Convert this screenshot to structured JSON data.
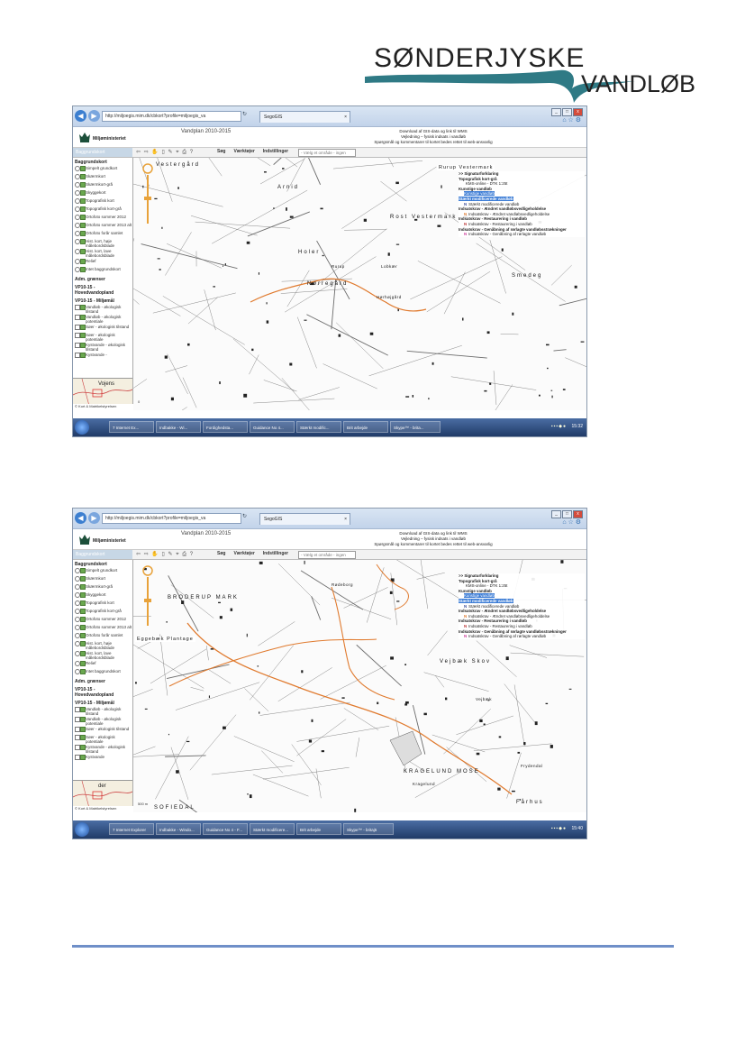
{
  "logo": {
    "line1": "SØNDERJYSKE",
    "line2": "VANDLØB",
    "swoosh_color": "#2f7a85"
  },
  "screenshots": [
    {
      "browser": {
        "url": "http://miljoegis.mim.dk/cbkort?profile=miljoegis_va",
        "tab_title": "SegoGIS",
        "tab_close": "×"
      },
      "app": {
        "ministry": "Miljøministeriet",
        "title": "Vandplan 2010-2015",
        "download_line": "Download af GIS-data og link til WMS",
        "guide_line": "Vejledning – fysisk indsats i vandløb",
        "comments_line": "Spørgsmål og kommentarer til kortet bedes rettet til web-ansvarlig"
      },
      "toolbar": {
        "tab": "Baggrundskort",
        "menu": [
          "Søg",
          "Værktøjer",
          "Indstillinger"
        ],
        "select": "- Vælg et område - ingen"
      },
      "sidebar": {
        "section1": "Baggrundskort",
        "items": [
          "Simpelt grundkort",
          "Skærmkort",
          "Skærmkort-grå",
          "Skyggekort",
          "Topografisk kort",
          "Topografisk kort-grå",
          "Ortofoto sommer 2012",
          "Ortofoto sommer 2013 alt",
          "Ortofoto forår samlet",
          "Hist. kort, høje målebordsblade",
          "Hist. kort, lave målebordsblade",
          "Relief",
          "Intet baggrundskort"
        ],
        "section2": "Adm. grænser",
        "section3": "VP10-15 - Hovedvandopland",
        "section4": "VP10-15 - Miljømål",
        "items2": [
          "Vandløb - økologisk tilstand",
          "Vandløb - økologisk potentiale",
          "Søer - økologisk tilstand",
          "Søer - økologisk potentiale",
          "Kystvande - økologisk tilstand",
          "Kystvande -"
        ],
        "credit": "© Kort & Matrikelstyrelsen"
      },
      "map": {
        "labels": [
          "Vestergård",
          "Arnid",
          "Rost Vestermark",
          "Holer",
          "Nørregård",
          "Smedeg"
        ],
        "box_label": "Rurup Vestermark",
        "minimap_label": "Vojens",
        "scale": "0",
        "small_labels": [
          "Lobkær",
          "Hørhøjgård",
          "Rurup"
        ]
      },
      "legend": {
        "header": ">> Signaturforklaring",
        "topo": "Topografisk kort-grå",
        "topo_sub": "KMS-online - DTK 1:25t",
        "kunstige": "Kunstige vandløb",
        "kunstige_item": "Kunstige vandløb",
        "staerkt": "Stærkt modificerede vandløb",
        "staerkt_item": "Stærkt modificerede vandløb",
        "indsats1": "Indsatskrav - Ændret vandløbsvedligeholdelse",
        "indsats1_item": "Indsatskrav - Ændret vandløbsvedligeholdelse",
        "indsats2": "Indsatskrav - Restaurering i vandløb",
        "indsats2_item": "Indsatskrav - Restaurering i vandløb",
        "indsats3": "Indsatskrav - Genåbning af rørlagte vandløbsstrækninger",
        "indsats3_item": "Indsatskrav - Genåbning af rørlagte vandløb"
      },
      "taskbar": {
        "items": [
          "7 Internet Ex...",
          "Indbakke - Wi...",
          "Fordighedsta...",
          "Guidance No 4...",
          "Stærkt modific...",
          "Brit arbejde"
        ],
        "extra": "Skype™ - brita...",
        "clock": "15:32"
      }
    },
    {
      "browser": {
        "url": "http://miljoegis.mim.dk/cbkort?profile=miljoegis_va",
        "tab_title": "SegoGIS",
        "tab_close": "×"
      },
      "app": {
        "ministry": "Miljøministeriet",
        "title": "Vandplan 2010-2015",
        "download_line": "Download af GIS-data og link til WMS",
        "guide_line": "Vejledning – fysisk indsats i vandløb",
        "comments_line": "Spørgsmål og kommentarer til kortet bedes rettet til web-ansvarlig"
      },
      "toolbar": {
        "tab": "Baggrundskort",
        "menu": [
          "Søg",
          "Værktøjer",
          "Indstillinger"
        ],
        "select": "- Vælg et område - ingen"
      },
      "sidebar": {
        "section1": "Baggrundskort",
        "items": [
          "Simpelt grundkort",
          "Skærmkort",
          "Skærmkort-grå",
          "Skyggekort",
          "Topografisk kort",
          "Topografisk kort-grå",
          "Ortofoto sommer 2012",
          "Ortofoto sommer 2013 alt",
          "Ortofoto forår samlet",
          "Hist. kort, høje målebordsblade",
          "Hist. kort, lave målebordsblade",
          "Relief",
          "Intet baggrundskort"
        ],
        "section2": "Adm. grænser",
        "section3": "VP10-15 - Hovedvandopland",
        "section4": "VP10-15 - Miljømål",
        "items2": [
          "Vandløb - økologisk tilstand",
          "Vandløb - økologisk potentiale",
          "Søer - økologisk tilstand",
          "Søer - økologisk potentiale",
          "Kystvande - økologisk tilstand",
          "Kystvande"
        ],
        "credit": "© Kort & Matrikelstyrelsen"
      },
      "map": {
        "labels": [
          "BRODERUP MARK",
          "Vejbæk Skov",
          "KRAGELUND MOSE",
          "SOFIEDAL",
          "Fårhus"
        ],
        "box_label": "Eggebæk Plantage",
        "minimap_label": "der",
        "scale": "500 m",
        "small_labels": [
          "Rødeborg",
          "Frydendal",
          "Kragelund",
          "Vejbæk"
        ]
      },
      "legend": {
        "header": ">> Signaturforklaring",
        "topo": "Topografisk kort-grå",
        "topo_sub": "KMS-online - DTK 1:25t",
        "kunstige": "Kunstige vandløb",
        "kunstige_item": "Kunstige vandløb",
        "staerkt": "Stærkt modificerede vandløb",
        "staerkt_item": "Stærkt modificerede vandløb",
        "indsats1": "Indsatskrav - Ændret vandløbsvedligeholdelse",
        "indsats1_item": "Indsatskrav - Ændret vandløbsvedligeholdelse",
        "indsats2": "Indsatskrav - Restaurering i vandløb",
        "indsats2_item": "Indsatskrav - Restaurering i vandløb",
        "indsats3": "Indsatskrav - Genåbning af rørlagte vandløbsstrækninger",
        "indsats3_item": "Indsatskrav - Genåbning af rørlagte vandløb"
      },
      "taskbar": {
        "items": [
          "7 Internet Explorer",
          "Indbakke - Windo...",
          "Guidance No 4 - F...",
          "Stærkt modificere...",
          "Brit arbejde"
        ],
        "extra": "Skype™ - britaj5",
        "clock": "15:40"
      }
    }
  ],
  "colors": {
    "river": "#e07a2e",
    "accent_footer": "#6f8fc8"
  }
}
